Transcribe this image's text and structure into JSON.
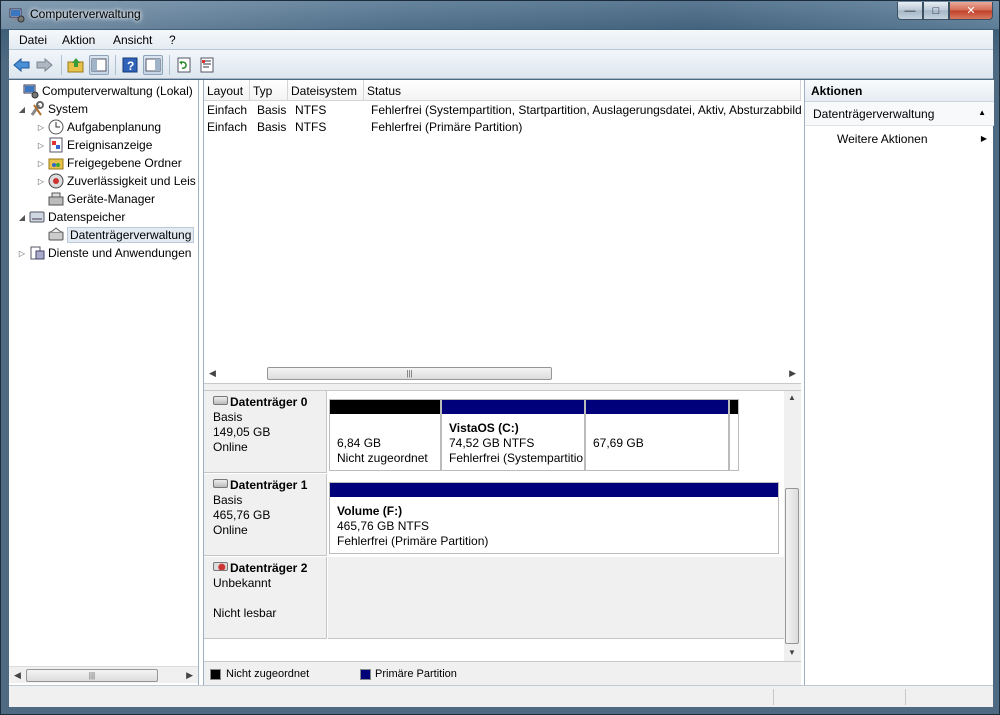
{
  "window": {
    "title": "Computerverwaltung",
    "minimize": "—",
    "maximize": "□",
    "close": "✕"
  },
  "menu": [
    "Datei",
    "Aktion",
    "Ansicht",
    "?"
  ],
  "toolbar": [
    "back-icon",
    "forward-icon",
    "up-folder-icon",
    "show-tree-icon",
    "help-icon",
    "show-pane-icon",
    "refresh-icon",
    "properties-icon"
  ],
  "tree": {
    "root": "Computerverwaltung (Lokal)",
    "system": "System",
    "aufgaben": "Aufgabenplanung",
    "ereignis": "Ereignisanzeige",
    "freigabe": "Freigegebene Ordner",
    "zuverl": "Zuverlässigkeit und Leis",
    "geraete": "Geräte-Manager",
    "datenspeicher": "Datenspeicher",
    "datentraeger": "Datenträgerverwaltung",
    "dienste": "Dienste und Anwendungen"
  },
  "list": {
    "headers": [
      "Layout",
      "Typ",
      "Dateisystem",
      "Status"
    ],
    "rows": [
      [
        "Einfach",
        "Basis",
        "NTFS",
        "Fehlerfrei (Systempartition, Startpartition, Auslagerungsdatei, Aktiv, Absturzabbild"
      ],
      [
        "Einfach",
        "Basis",
        "NTFS",
        "Fehlerfrei (Primäre Partition)"
      ]
    ]
  },
  "disks": {
    "d0": {
      "name": "Datenträger 0",
      "type": "Basis",
      "size": "149,05 GB",
      "state": "Online",
      "p1": {
        "size": "6,84 GB",
        "status": "Nicht zugeordnet"
      },
      "p2": {
        "name": "VistaOS  (C:)",
        "size": "74,52 GB NTFS",
        "status": "Fehlerfrei (Systempartitio"
      },
      "p3": {
        "size": "67,69 GB"
      }
    },
    "d1": {
      "name": "Datenträger 1",
      "type": "Basis",
      "size": "465,76 GB",
      "state": "Online",
      "p1": {
        "name": "Volume  (F:)",
        "size": "465,76 GB NTFS",
        "status": "Fehlerfrei (Primäre Partition)"
      }
    },
    "d2": {
      "name": "Datenträger 2",
      "type": "Unbekannt",
      "state": "Nicht lesbar"
    }
  },
  "legend": {
    "unallocated": "Nicht zugeordnet",
    "primary": "Primäre Partition"
  },
  "actions": {
    "header": "Aktionen",
    "section": "Datenträgerverwaltung",
    "more": "Weitere Aktionen"
  },
  "colors": {
    "unallocated": "#000000",
    "primary": "#00007b"
  }
}
